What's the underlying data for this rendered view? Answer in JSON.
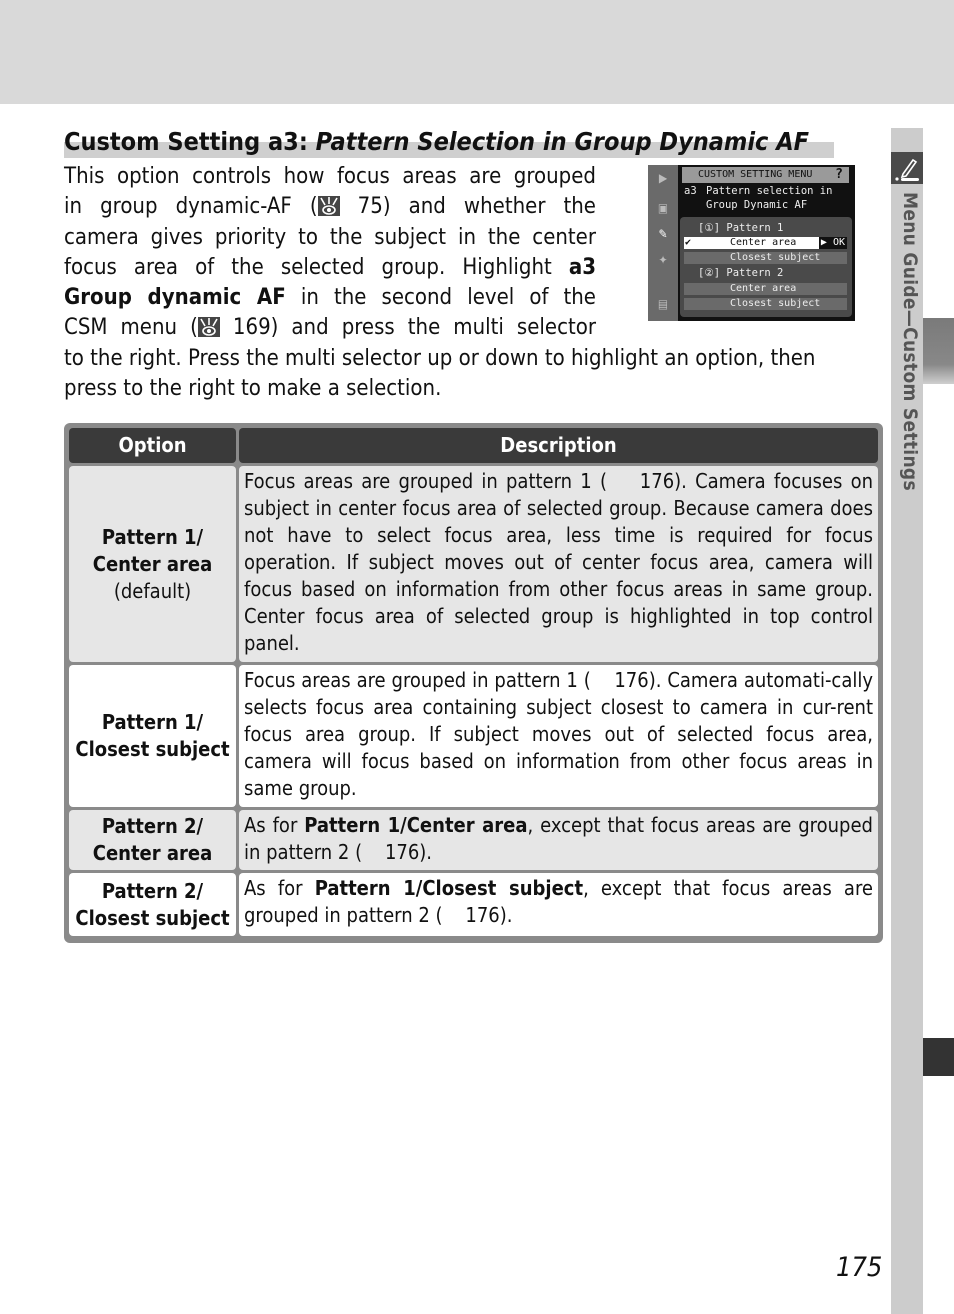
{
  "header": {
    "title_prefix": "Custom Setting a3: ",
    "title_italic": "Pattern Selection in Group Dynamic AF"
  },
  "intro": {
    "lines_narrow": [
      "This option controls how focus areas are grouped",
      "in group dynamic-AF (",
      "camera gives priority to the subject in the center",
      "focus area of the selected group.  Highlight ",
      "in the second level of the",
      "CSM menu ("
    ],
    "ref_75": " 75) and whether the",
    "bold_a3": "a3",
    "bold_group": "Group dynamic AF",
    "ref_169": " 169) and press the multi selector",
    "line_wide_1": "to the right.  Press the multi selector up or down to highlight an option, then",
    "line_wide_2": "press to the right to make a selection."
  },
  "camera_screen": {
    "menu_title": "CUSTOM SETTING MENU",
    "help_icon": "?",
    "item_code": "a3",
    "item_line1": "Pattern selection in",
    "item_line2": "Group Dynamic AF",
    "pattern1_label": "Pattern 1",
    "pattern2_label": "Pattern 2",
    "options": [
      {
        "label": "Center area",
        "selected": true,
        "checked": true
      },
      {
        "label": "Closest subject",
        "selected": false
      },
      {
        "label": "Center area",
        "selected": false
      },
      {
        "label": "Closest subject",
        "selected": false
      }
    ],
    "ok_label": "▶ OK",
    "check_mark": "✔",
    "side_icons": [
      "playback-icon",
      "camera-icon",
      "pencil-icon",
      "wrench-icon",
      "recent-settings-icon"
    ]
  },
  "table": {
    "headers": [
      "Option",
      "Description"
    ],
    "rows": [
      {
        "option_line1": "Pattern 1/",
        "option_line2": "Center area",
        "option_note": "(default)",
        "description": "Focus areas are grouped in pattern 1 (    176).  Camera focuses on subject in center focus area of selected group.  Because camera does not have to select focus area, less time is required for focus operation.  If subject moves out of center focus area, camera will focus based on information from other focus areas in same group. Center focus area of selected group is highlighted in top control panel."
      },
      {
        "option_line1": "Pattern 1/",
        "option_line2": "Closest subject",
        "description": "Focus areas are grouped in pattern 1 (    176).  Camera automati-cally selects focus area containing subject closest to camera in cur-rent focus area group.  If subject moves out of selected focus area, camera will focus based on information from other focus areas in same group."
      },
      {
        "option_line1": "Pattern 2/",
        "option_line2": "Center area",
        "desc_pre": "As for ",
        "desc_bold": "Pattern 1/Center area",
        "desc_post": ", except that focus areas are grouped in pattern 2 (    176)."
      },
      {
        "option_line1": "Pattern 2/",
        "option_line2": "Closest subject",
        "desc_pre": "As for ",
        "desc_bold": "Pattern 1/Closest subject",
        "desc_post": ", except that focus areas are grouped in pattern 2 (    176)."
      }
    ]
  },
  "sidebar": {
    "section_label": "Menu Guide—Custom Settings",
    "icon": "pencil-icon"
  },
  "footer": {
    "page_number": "175"
  }
}
